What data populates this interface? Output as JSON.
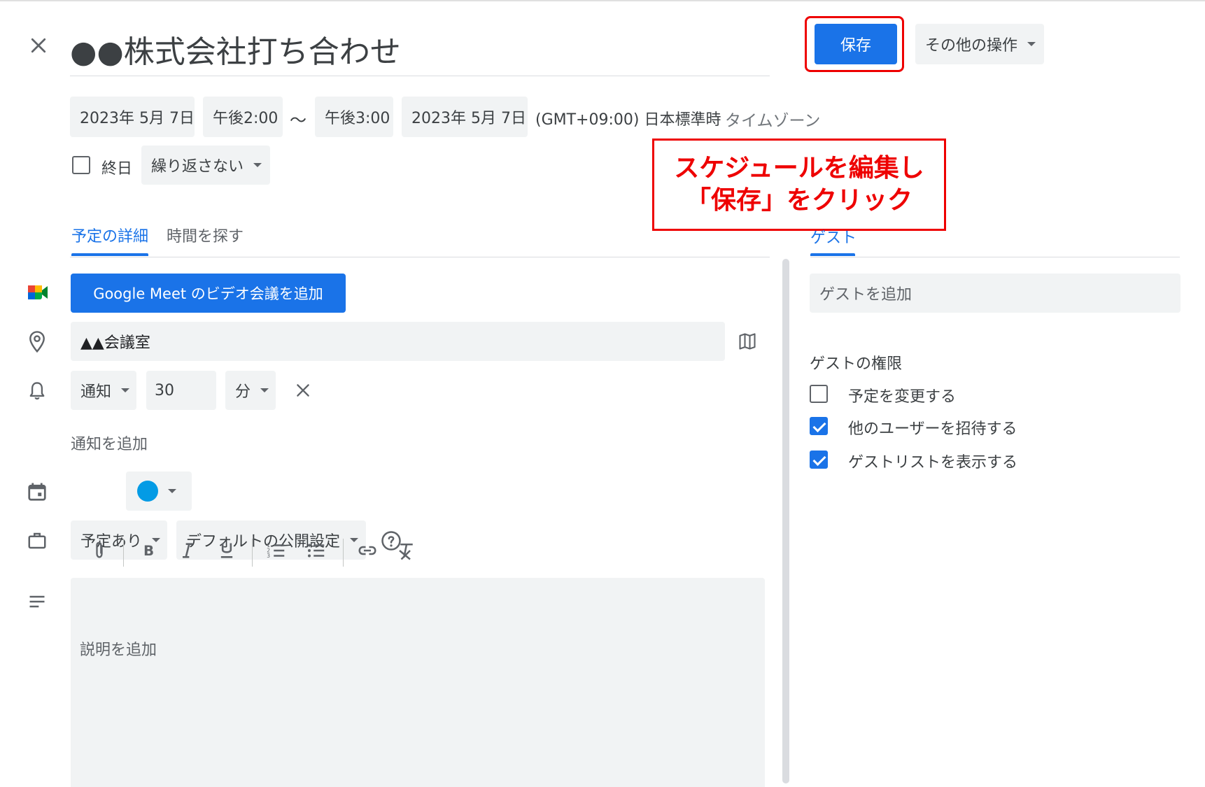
{
  "header": {
    "title": "●●株式会社打ち合わせ",
    "save_label": "保存",
    "more_actions_label": "その他の操作"
  },
  "datetime": {
    "start_date": "2023年 5月 7日",
    "start_time": "午後2:00",
    "separator": "～",
    "end_time": "午後3:00",
    "end_date": "2023年 5月 7日",
    "timezone_value": "(GMT+09:00) 日本標準時",
    "timezone_link": "タイムゾーン",
    "all_day_label": "終日",
    "repeat_label": "繰り返さない"
  },
  "callout": {
    "line1": "スケジュールを編集し",
    "line2": "「保存」をクリック",
    "color": "#ee0000"
  },
  "tabs": {
    "details": "予定の詳細",
    "find_time": "時間を探す",
    "guests": "ゲスト"
  },
  "details": {
    "meet_button": "Google Meet のビデオ会議を追加",
    "location_value": "▲▲会議室",
    "notification_type": "通知",
    "notification_value": "30",
    "notification_unit": "分",
    "add_notification": "通知を追加",
    "event_color": "#039be5",
    "availability": "予定あり",
    "visibility": "デフォルトの公開設定",
    "description_placeholder": "説明を追加"
  },
  "guests": {
    "add_guest_placeholder": "ゲストを追加",
    "permissions_title": "ゲストの権限",
    "permissions": [
      {
        "label": "予定を変更する",
        "checked": false
      },
      {
        "label": "他のユーザーを招待する",
        "checked": true
      },
      {
        "label": "ゲストリストを表示する",
        "checked": true
      }
    ]
  },
  "colors": {
    "accent": "#1a73e8",
    "chip_bg": "#f1f3f4",
    "highlight": "#ee0000"
  }
}
